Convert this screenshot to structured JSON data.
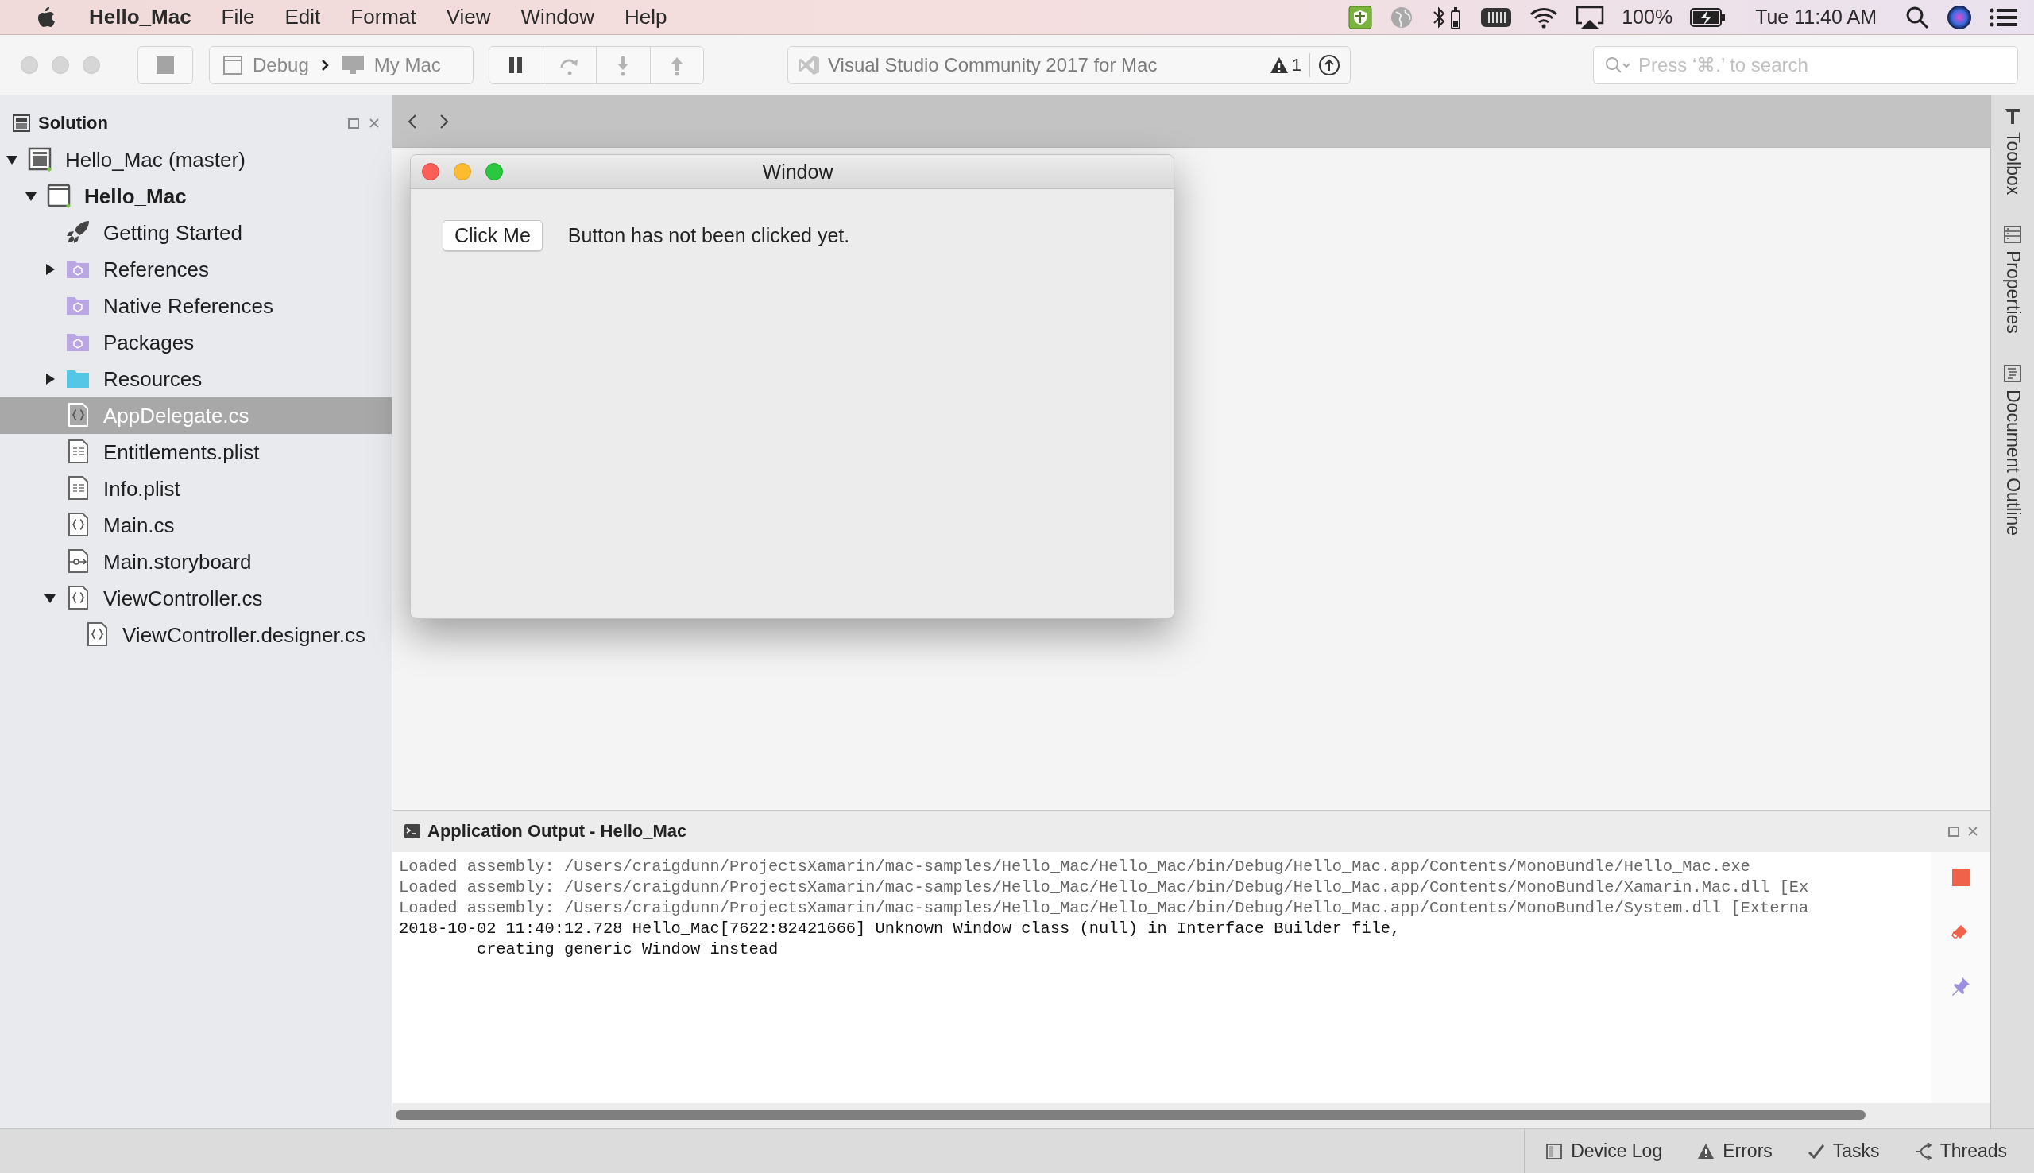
{
  "menu_bar": {
    "app_name": "Hello_Mac",
    "menus": [
      "File",
      "Edit",
      "Format",
      "View",
      "Window",
      "Help"
    ],
    "battery_percent": "100%",
    "clock": "Tue 11:40 AM"
  },
  "toolbar": {
    "configuration": "Debug",
    "target": "My Mac",
    "run_controls": [
      {
        "kind": "pause",
        "disabled": false
      },
      {
        "kind": "step-over",
        "disabled": true
      },
      {
        "kind": "step-into",
        "disabled": true
      },
      {
        "kind": "step-out",
        "disabled": true
      }
    ],
    "status_text": "Visual Studio Community 2017 for Mac",
    "warning_count": "1",
    "search": {
      "placeholder": "Press ‘⌘.’ to search"
    }
  },
  "solution_pad": {
    "title": "Solution",
    "tree": [
      {
        "label": "Hello_Mac (master)",
        "kind": "solution",
        "selected": false,
        "expanded": true,
        "children": [
          {
            "label": "Hello_Mac",
            "kind": "project",
            "selected": false,
            "expanded": true,
            "children": [
              {
                "label": "Getting Started",
                "kind": "rocket",
                "selected": false
              },
              {
                "label": "References",
                "kind": "ref-folder",
                "selected": false,
                "expanded": false
              },
              {
                "label": "Native References",
                "kind": "ref-folder",
                "selected": false
              },
              {
                "label": "Packages",
                "kind": "ref-folder",
                "selected": false
              },
              {
                "label": "Resources",
                "kind": "folder",
                "selected": false,
                "expanded": false
              },
              {
                "label": "AppDelegate.cs",
                "kind": "code",
                "selected": true
              },
              {
                "label": "Entitlements.plist",
                "kind": "plist",
                "selected": false
              },
              {
                "label": "Info.plist",
                "kind": "plist",
                "selected": false
              },
              {
                "label": "Main.cs",
                "kind": "code",
                "selected": false
              },
              {
                "label": "Main.storyboard",
                "kind": "storyboard",
                "selected": false
              },
              {
                "label": "ViewController.cs",
                "kind": "code",
                "selected": false,
                "expanded": true,
                "children": [
                  {
                    "label": "ViewController.designer.cs",
                    "kind": "code",
                    "selected": false
                  }
                ]
              }
            ]
          }
        ]
      }
    ]
  },
  "designer": {
    "window": {
      "title": "Window",
      "button": "Click Me",
      "label": "Button has not been clicked yet."
    }
  },
  "output_pad": {
    "title": "Application Output - Hello_Mac",
    "lines": [
      {
        "kind": "info",
        "text": "Loaded assembly: /Users/craigdunn/ProjectsXamarin/mac-samples/Hello_Mac/Hello_Mac/bin/Debug/Hello_Mac.app/Contents/MonoBundle/Hello_Mac.exe"
      },
      {
        "kind": "info",
        "text": "Loaded assembly: /Users/craigdunn/ProjectsXamarin/mac-samples/Hello_Mac/Hello_Mac/bin/Debug/Hello_Mac.app/Contents/MonoBundle/Xamarin.Mac.dll [Ex"
      },
      {
        "kind": "info",
        "text": "Loaded assembly: /Users/craigdunn/ProjectsXamarin/mac-samples/Hello_Mac/Hello_Mac/bin/Debug/Hello_Mac.app/Contents/MonoBundle/System.dll [Externa"
      },
      {
        "kind": "message",
        "text": "2018-10-02 11:40:12.728 Hello_Mac[7622:82421666] Unknown Window class (null) in Interface Builder file,"
      },
      {
        "kind": "continuation",
        "text": "creating generic Window instead"
      }
    ]
  },
  "side_tabs": [
    {
      "label": "Toolbox",
      "kind": "toolbox"
    },
    {
      "label": "Properties",
      "kind": "properties"
    },
    {
      "label": "Document Outline",
      "kind": "outline"
    }
  ],
  "status_bar": {
    "buttons": [
      {
        "label": "Device Log",
        "kind": "device-log"
      },
      {
        "label": "Errors",
        "kind": "errors"
      },
      {
        "label": "Tasks",
        "kind": "tasks"
      },
      {
        "label": "Threads",
        "kind": "threads"
      }
    ]
  }
}
